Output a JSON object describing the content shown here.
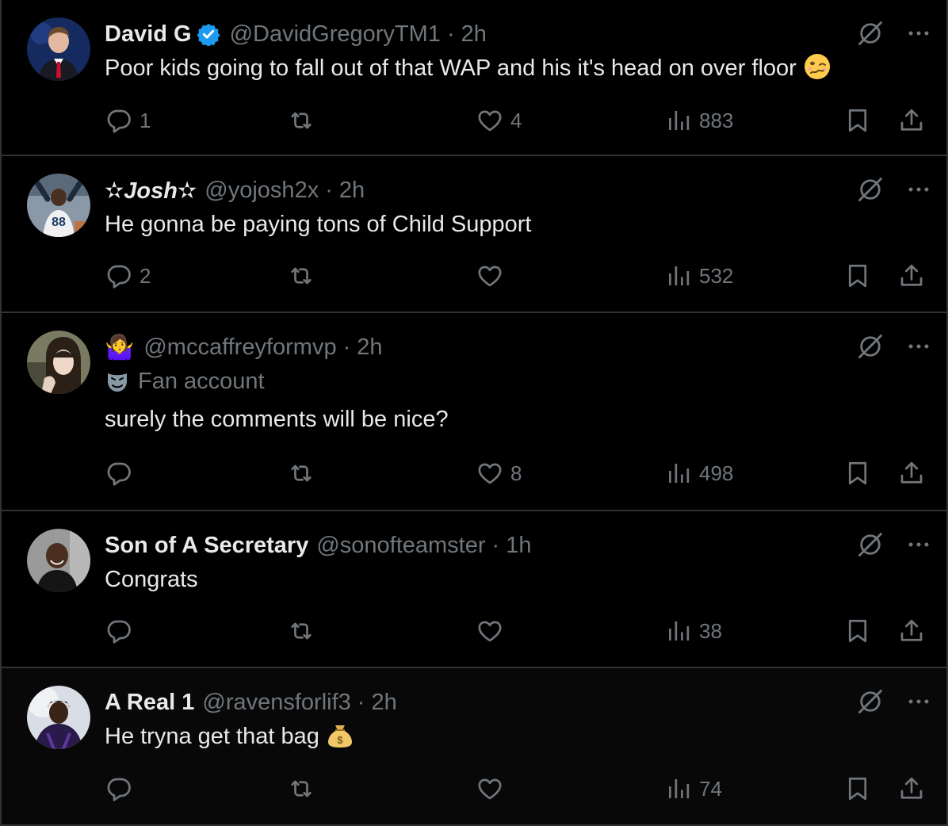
{
  "tweets": [
    {
      "name": "David G",
      "verified": true,
      "handle": "@DavidGregoryTM1",
      "time": "2h",
      "text": "Poor kids going to fall out of that WAP and his it's head on over floor",
      "emoji": "woozy-face",
      "replies": "1",
      "retweets": "",
      "likes": "4",
      "views": "883"
    },
    {
      "name": "✫Josh✫",
      "verified": false,
      "handle": "@yojosh2x",
      "time": "2h",
      "text": "He gonna be paying tons of Child Support",
      "replies": "2",
      "retweets": "",
      "likes": "",
      "views": "532"
    },
    {
      "name_emoji": "🤷‍♀️",
      "handle": "@mccaffreyformvp",
      "time": "2h",
      "label": "Fan account",
      "text": "surely the comments will be nice?",
      "replies": "",
      "retweets": "",
      "likes": "8",
      "views": "498"
    },
    {
      "name": "Son of A Secretary",
      "handle": "@sonofteamster",
      "time": "1h",
      "text": "Congrats",
      "replies": "",
      "retweets": "",
      "likes": "",
      "views": "38"
    },
    {
      "name": "A Real 1",
      "handle": "@ravensforlif3",
      "time": "2h",
      "text": "He tryna get that bag",
      "emoji": "money-bag",
      "replies": "",
      "retweets": "",
      "likes": "",
      "views": "74"
    }
  ],
  "separator": "·",
  "colors": {
    "background": "#000000",
    "text": "#e7e9ea",
    "secondary": "#71767b",
    "border": "#2f3336",
    "verified": "#1d9bf0"
  }
}
